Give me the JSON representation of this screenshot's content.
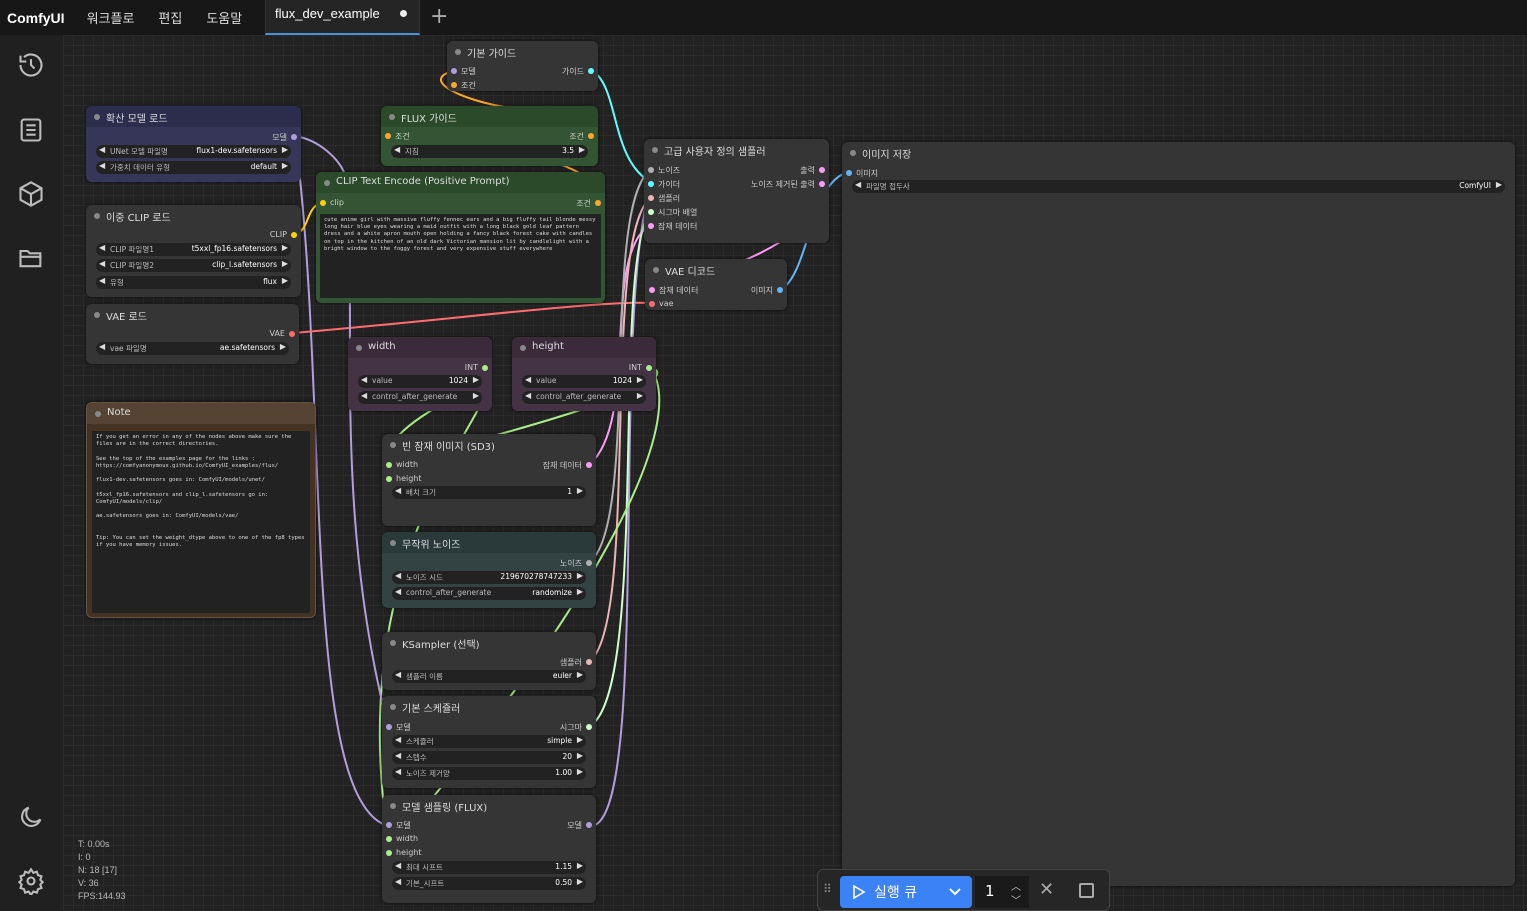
{
  "app": {
    "logo": "ComfyUI"
  },
  "menu": [
    "워크플로",
    "편집",
    "도움말"
  ],
  "tab": {
    "title": "flux_dev_example"
  },
  "nodes": {
    "basic_guide": {
      "title": "기본 가이드",
      "in_model": "모델",
      "in_cond": "조건",
      "out_guide": "가이드"
    },
    "flux_guide": {
      "title": "FLUX 가이드",
      "in_cond": "조건",
      "out_cond": "조건",
      "w_label": "지침",
      "w_value": "3.5"
    },
    "diff_model": {
      "title": "확산 모델 로드",
      "out_model": "모델",
      "w1_label": "UNet 모델 파일명",
      "w1_value": "flux1-dev.safetensors",
      "w2_label": "가중치 데이터 유형",
      "w2_value": "default"
    },
    "clip_text": {
      "title": "CLIP Text Encode (Positive Prompt)",
      "in_clip": "clip",
      "out_cond": "조건",
      "text": "cute anime girl with massive fluffy fennec ears and a big fluffy tail blonde messy long hair blue eyes wearing a maid outfit with a long black gold leaf pattern dress and a white apron mouth open holding a fancy black forest cake with candles on top in the kitchen of an old dark Victorian mansion lit by candlelight with a bright window to the foggy forest and very expensive stuff everywhere"
    },
    "dual_clip": {
      "title": "이중 CLIP 로드",
      "out_clip": "CLIP",
      "w1_label": "CLIP 파일명1",
      "w1_value": "t5xxl_fp16.safetensors",
      "w2_label": "CLIP 파일명2",
      "w2_value": "clip_l.safetensors",
      "w3_label": "유형",
      "w3_value": "flux"
    },
    "vae_load": {
      "title": "VAE 로드",
      "out_vae": "VAE",
      "w_label": "vae 파일명",
      "w_value": "ae.safetensors"
    },
    "adv_sampler": {
      "title": "고급 사용자 정의 샘플러",
      "in_noise": "노이즈",
      "in_guider": "가이더",
      "in_sampler": "샘플러",
      "in_sigma": "시그마 배열",
      "in_latent": "잠재 데이터",
      "out_out": "출력",
      "out_denoised": "노이즈 제거된 출력"
    },
    "vae_decode": {
      "title": "VAE 디코드",
      "in_latent": "잠재 데이터",
      "in_vae": "vae",
      "out_image": "이미지"
    },
    "save_image": {
      "title": "이미지 저장",
      "in_image": "이미지",
      "w_label": "파일명 접두사",
      "w_value": "ComfyUI"
    },
    "width": {
      "title": "width",
      "out_int": "INT",
      "w1_label": "value",
      "w1_value": "1024",
      "w2_label": "control_after_generate"
    },
    "height": {
      "title": "height",
      "out_int": "INT",
      "w1_label": "value",
      "w1_value": "1024",
      "w2_label": "control_after_generate"
    },
    "note": {
      "title": "Note",
      "text": "If you get an error in any of the nodes above make sure the files are in the correct directories.\n\nSee the top of the examples page for the links :\nhttps://comfyanonymous.github.io/ComfyUI_examples/flux/\n\nflux1-dev.safetensors goes in: ComfyUI/models/unet/\n\nt5xxl_fp16.safetensors and clip_l.safetensors go in: ComfyUI/models/clip/\n\nae.safetensors goes in: ComfyUI/models/vae/\n\n\nTip: You can set the weight_dtype above to one of the fp8 types if you have memory issues."
    },
    "empty_latent": {
      "title": "빈 잠재 이미지 (SD3)",
      "in_width": "width",
      "in_height": "height",
      "out_latent": "잠재 데이터",
      "w_label": "배치 크기",
      "w_value": "1"
    },
    "random_noise": {
      "title": "무작위 노이즈",
      "out_noise": "노이즈",
      "w1_label": "노이즈 시드",
      "w1_value": "219670278747233",
      "w2_label": "control_after_generate",
      "w2_value": "randomize"
    },
    "ksampler_select": {
      "title": "KSampler (선택)",
      "out_sampler": "샘플러",
      "w_label": "샘플러 이름",
      "w_value": "euler"
    },
    "basic_scheduler": {
      "title": "기본 스케쥴러",
      "in_model": "모델",
      "out_sigma": "시그마",
      "w1_label": "스케쥴러",
      "w1_value": "simple",
      "w2_label": "스텝수",
      "w2_value": "20",
      "w3_label": "노이즈 제거양",
      "w3_value": "1.00"
    },
    "model_sampling": {
      "title": "모델 샘플링 (FLUX)",
      "in_model": "모델",
      "in_width": "width",
      "in_height": "height",
      "out_model": "모델",
      "w1_label": "최대 시프트",
      "w1_value": "1.15",
      "w2_label": "기본_시프트",
      "w2_value": "0.50"
    }
  },
  "stats": {
    "t": "T: 0.00s",
    "i": "I: 0",
    "n": "N: 18 [17]",
    "v": "V: 36",
    "fps": "FPS:144.93"
  },
  "run": {
    "label": "실행 큐",
    "count": "1"
  },
  "colors": {
    "accent": "#3b82f6",
    "model": "#b39ddb",
    "clip": "#ffd500",
    "cond": "#ffa931",
    "vae": "#ff6e6e",
    "latent": "#ff9cf9",
    "image": "#64b5f6",
    "int": "#aaee88",
    "noise": "#b0b0b0",
    "guider": "#66ffff",
    "sampler": "#ecb4b4",
    "sigma": "#cdffcd"
  }
}
